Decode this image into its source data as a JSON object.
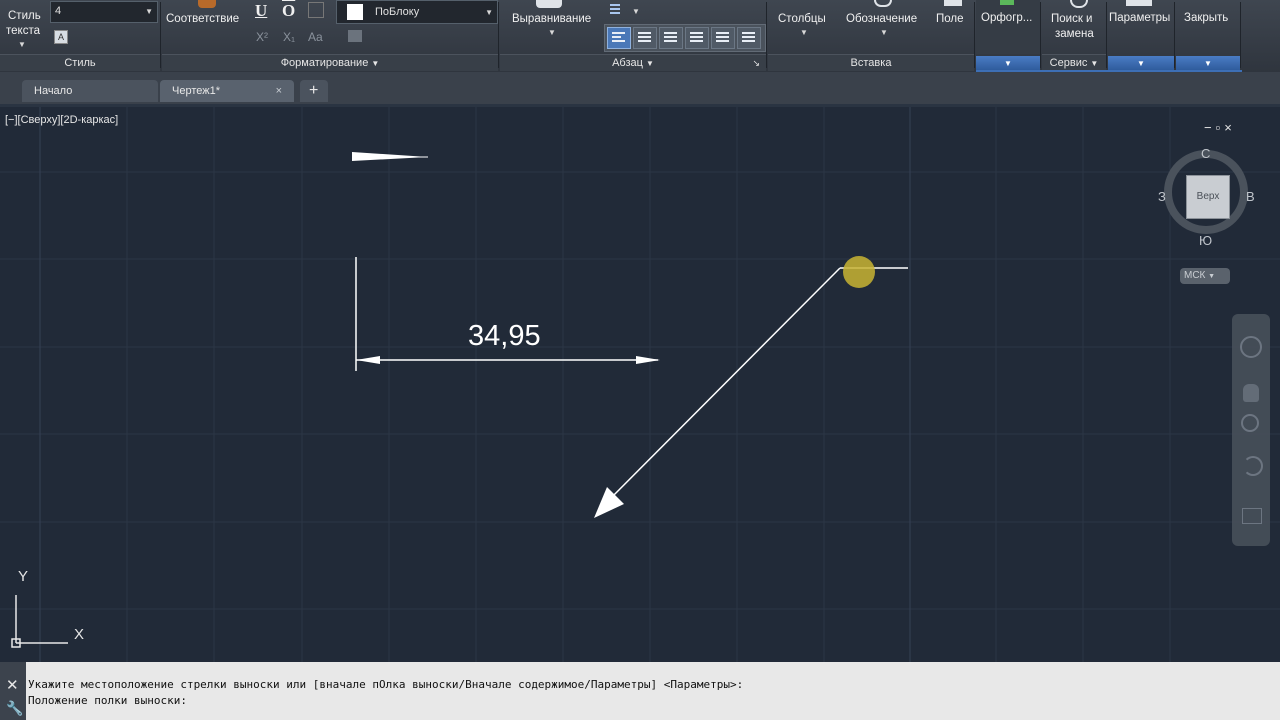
{
  "ribbon": {
    "style_panel": {
      "button_label_line1": "Стиль",
      "button_label_line2": "текста",
      "height_value": "4",
      "title": "Стиль"
    },
    "formatting_panel": {
      "match_label": "Соответствие",
      "bold": "U",
      "overline": "O",
      "color_value": "ПоБлоку",
      "superscript": "X²",
      "subscript": "X₁",
      "case": "Aa",
      "title": "Форматирование"
    },
    "paragraph_panel": {
      "justification_label": "Выравнивание",
      "title": "Абзац"
    },
    "insert_panel": {
      "columns_label": "Столбцы",
      "symbol_label": "Обозначение",
      "field_label": "Поле",
      "title": "Вставка"
    },
    "spell_panel": {
      "label": "Орфогр..."
    },
    "tools_panel": {
      "find_line1": "Поиск и",
      "find_line2": "замена",
      "title": "Сервис"
    },
    "options_label": "Параметры",
    "close_label": "Закрыть"
  },
  "tabs": [
    {
      "label": "Начало",
      "active": false
    },
    {
      "label": "Чертеж1*",
      "active": true
    }
  ],
  "tab_add": "+",
  "tab_close": "×",
  "viewport": {
    "controls": "[−][Сверху][2D-каркас]",
    "dimension_text": "34,95",
    "background": "#212a38"
  },
  "viewcube": {
    "north": "С",
    "south": "Ю",
    "west": "З",
    "east": "В",
    "face": "Верх",
    "ucs": "МСК"
  },
  "ucs_icon": {
    "x": "X",
    "y": "Y"
  },
  "command_history": [
    "Укажите местоположение стрелки выноски или [вначале пОлка выноски/Вначале содержимое/Параметры] <Параметры>:",
    "Положение полки выноски:"
  ],
  "colors": {
    "accent_blue": "#3d6fb5",
    "leader_marker": "#c8b432"
  }
}
